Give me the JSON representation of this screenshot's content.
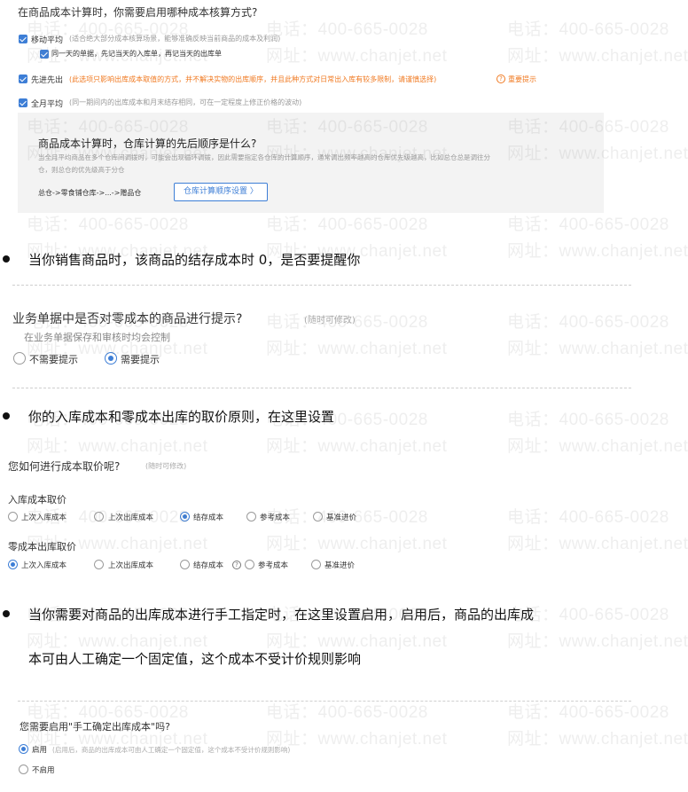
{
  "section1": {
    "question": "在商品成本计算时，你需要启用哪种成本核算方式?",
    "moving_avg_label": "移动平均",
    "moving_avg_desc": "(适合绝大部分成本核算场景，能够准确反映当前商品的成本及利润)",
    "same_day_label": "同一天的单据，先记当天的入库单，再记当天的出库单",
    "fifo_label": "先进先出",
    "fifo_desc": "(此选项只影响出库成本取值的方式，并不解决实物的出库顺序，并且此种方式对日常出入库有较多限制，请谨慎选择)",
    "important_tip": "重要提示",
    "monthly_avg_label": "全月平均",
    "monthly_avg_desc": "(同一期间内的出库成本和月末结存相同，可在一定程度上修正价格的波动)"
  },
  "warehouse_box": {
    "title": "商品成本计算时，仓库计算的先后顺序是什么?",
    "desc_line1": "当全月平均商品在多个仓库间调拨时，可能会出现循环调拨，因此需要指定各仓库的计算顺序，通常调出频率越高的仓库优先级越高，比如总仓总是调往分",
    "desc_line2": "仓，则总仓的优先级高于分仓",
    "order": "总仓->零食铺仓库->...->赠品仓",
    "button": "仓库计算顺序设置 〉"
  },
  "bullet1": "当你销售商品时，该商品的结存成本时 0，是否要提醒你",
  "zero_cost": {
    "question": "业务单据中是否对零成本的商品进行提示?",
    "hint": "(随时可修改)",
    "subtitle": "在业务单据保存和审核时均会控制",
    "opt_no": "不需要提示",
    "opt_yes": "需要提示",
    "selected": "需要提示"
  },
  "bullet2": "你的入库成本和零成本出库的取价原则，在这里设置",
  "pricing": {
    "question": "您如何进行成本取价呢?",
    "hint": "(随时可修改)",
    "inbound_label": "入库成本取价",
    "inbound_options": [
      "上次入库成本",
      "上次出库成本",
      "结存成本",
      "参考成本",
      "基准进价"
    ],
    "inbound_selected": "结存成本",
    "zero_label": "零成本出库取价",
    "zero_options": [
      "上次入库成本",
      "上次出库成本",
      "结存成本",
      "参考成本",
      "基准进价"
    ],
    "zero_selected": "上次入库成本"
  },
  "bullet3_line1": "当你需要对商品的出库成本进行手工指定时，在这里设置启用，启用后，商品的出库成",
  "bullet3_line2": "本可由人工确定一个固定值，这个成本不受计价规则影响",
  "manual": {
    "question": "您需要启用\"手工确定出库成本\"吗?",
    "enable_label": "启用",
    "enable_desc": "(启用后，商品的出库成本可由人工确定一个固定值，这个成本不受计价规则影响)",
    "disable_label": "不启用",
    "selected": "启用"
  },
  "watermark": {
    "phone": "电话：400-665-0028",
    "site": "网址：www.chanjet.net"
  },
  "colors": {
    "accent": "#3d7ed6",
    "warning": "#f07a22"
  }
}
